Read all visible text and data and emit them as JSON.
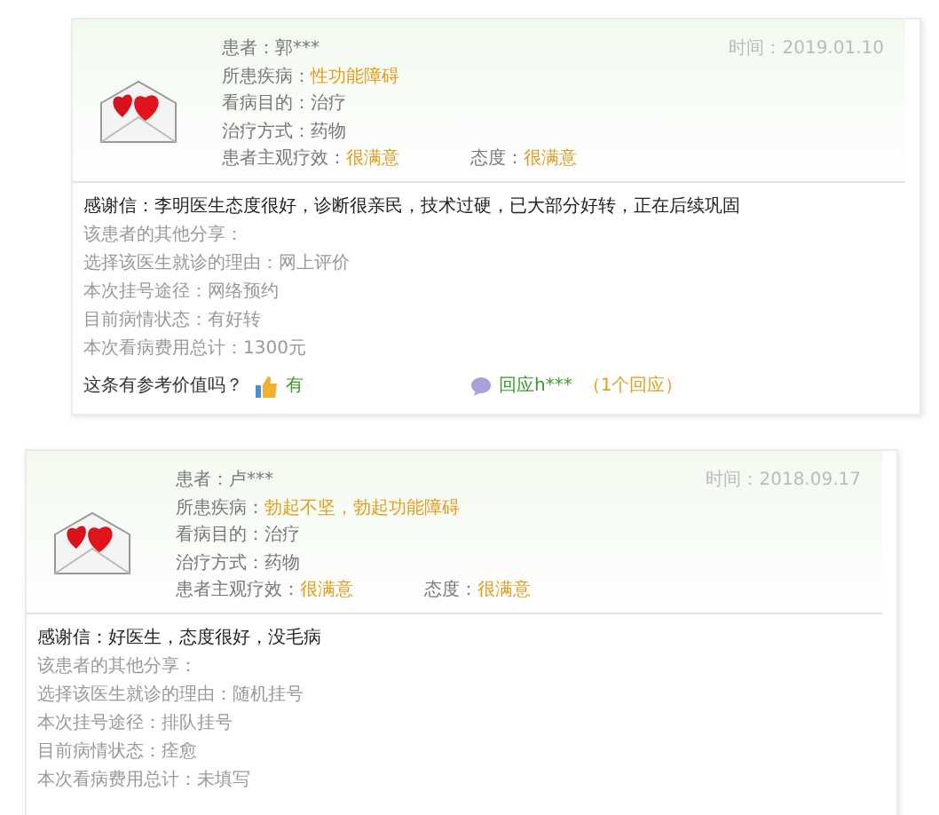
{
  "reviews": [
    {
      "time": "时间：2019.01.10",
      "header_rows": [
        [
          {
            "label": "患者：",
            "value": "郭***",
            "highlight": false
          }
        ],
        [
          {
            "label": "所患疾病：",
            "value": "性功能障碍",
            "highlight": true
          }
        ],
        [
          {
            "label": "看病目的：",
            "value": "治疗",
            "highlight": false
          }
        ],
        [
          {
            "label": "治疗方式：",
            "value": "药物",
            "highlight": false
          }
        ],
        [
          {
            "label": "患者主观疗效：",
            "value": "很满意",
            "highlight": true
          },
          {
            "label": "态度：",
            "value": "很满意",
            "highlight": true
          }
        ]
      ],
      "body": [
        {
          "text": "感谢信：李明医生态度很好，诊断很亲民，技术过硬，已大部分好转，正在后续巩固",
          "emphasis": true
        },
        {
          "text": "该患者的其他分享：",
          "emphasis": false
        },
        {
          "text": "选择该医生就诊的理由：网上评价",
          "emphasis": false
        },
        {
          "text": "本次挂号途径：网络预约",
          "emphasis": false
        },
        {
          "text": "目前病情状态：有好转",
          "emphasis": false
        },
        {
          "text": "本次看病费用总计：1300元",
          "emphasis": false
        }
      ],
      "footer": {
        "question": "这条有参考价值吗？",
        "vote": "有",
        "reply": "回应h***",
        "reply_count": "（1个回应）"
      }
    },
    {
      "time": "时间：2018.09.17",
      "header_rows": [
        [
          {
            "label": "患者：",
            "value": "卢***",
            "highlight": false
          }
        ],
        [
          {
            "label": "所患疾病：",
            "value": "勃起不坚，勃起功能障碍",
            "highlight": true
          }
        ],
        [
          {
            "label": "看病目的：",
            "value": "治疗",
            "highlight": false
          }
        ],
        [
          {
            "label": "治疗方式：",
            "value": "药物",
            "highlight": false
          }
        ],
        [
          {
            "label": "患者主观疗效：",
            "value": "很满意",
            "highlight": true
          },
          {
            "label": "态度：",
            "value": "很满意",
            "highlight": true
          }
        ]
      ],
      "body": [
        {
          "text": "感谢信：好医生，态度很好，没毛病",
          "emphasis": true
        },
        {
          "text": "该患者的其他分享：",
          "emphasis": false
        },
        {
          "text": "选择该医生就诊的理由：随机挂号",
          "emphasis": false
        },
        {
          "text": "本次挂号途径：排队挂号",
          "emphasis": false
        },
        {
          "text": "目前病情状态：痊愈",
          "emphasis": false
        },
        {
          "text": "本次看病费用总计：未填写",
          "emphasis": false
        }
      ]
    }
  ]
}
